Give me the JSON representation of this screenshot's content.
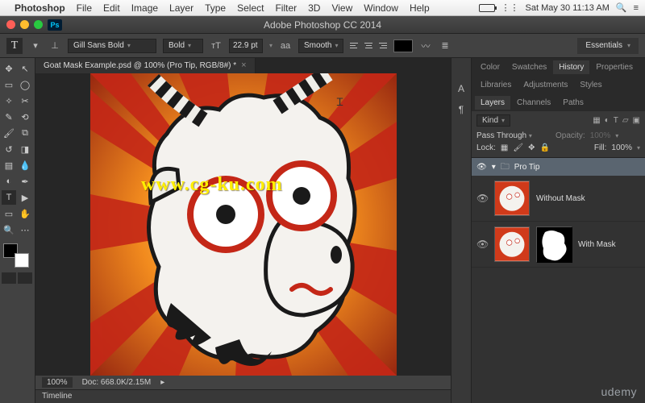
{
  "mac_menu": {
    "app": "Photoshop",
    "items": [
      "File",
      "Edit",
      "Image",
      "Layer",
      "Type",
      "Select",
      "Filter",
      "3D",
      "View",
      "Window",
      "Help"
    ],
    "clock": "Sat May 30  11:13 AM"
  },
  "window": {
    "title": "Adobe Photoshop CC 2014",
    "ps_badge": "Ps"
  },
  "options": {
    "tool_letter": "T",
    "font_family": "Gill Sans Bold",
    "font_style": "Bold",
    "font_size": "22.9 pt",
    "aa_label": "aa",
    "aa_value": "Smooth",
    "workspace": "Essentials"
  },
  "document": {
    "tab_label": "Goat Mask Example.psd @ 100% (Pro Tip, RGB/8#) *",
    "zoom": "100%",
    "doc_size": "Doc: 668.0K/2.15M",
    "timeline_label": "Timeline"
  },
  "panels": {
    "row1": [
      "Color",
      "Swatches",
      "History",
      "Properties"
    ],
    "row1_active": 2,
    "row2": [
      "Libraries",
      "Adjustments",
      "Styles"
    ],
    "row3": [
      "Layers",
      "Channels",
      "Paths"
    ],
    "row3_active": 0
  },
  "layers": {
    "filter_label": "Kind",
    "blend_mode": "Pass Through",
    "opacity_label": "Opacity:",
    "opacity_value": "100%",
    "lock_label": "Lock:",
    "fill_label": "Fill:",
    "fill_value": "100%",
    "group_name": "Pro Tip",
    "items": [
      {
        "name": "Without Mask",
        "has_mask": false
      },
      {
        "name": "With Mask",
        "has_mask": true
      }
    ]
  },
  "watermark": "www.cg-ku.com",
  "brand": "udemy"
}
